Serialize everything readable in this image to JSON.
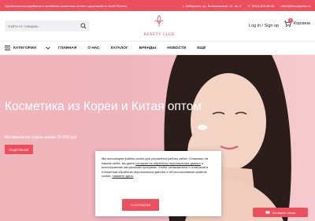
{
  "topbar": {
    "tagline": "Оригинальная корейская и китайская косметика оптом с доставкой по всей России",
    "address": "г. Хабаровск, ул. Большевиков, 12, кв. 4",
    "phone": "+7 (914) 409-89-98",
    "email": "office@beautyclub.ru",
    "color": "#ec4f5e"
  },
  "header": {
    "search_placeholder": "Найти по товарам...",
    "logo_text": "BEAUTY CLUB",
    "account_label": "Log in / Sign up",
    "cart_label": "Корзина",
    "cart_count": "0"
  },
  "nav": {
    "categories_label": "КАТЕГОРИИ",
    "items": [
      "ГЛАВНАЯ",
      "О НАС",
      "КАТАЛОГ",
      "БРЕНДЫ",
      "НОВОСТИ",
      "ЕЩЁ"
    ]
  },
  "hero": {
    "title": "Косметика из Кореи и Китая оптом",
    "subtitle": "Минимальная сумма заказа 10 000 руб.",
    "button": "ПОДРОБНЕЕ"
  },
  "cookie": {
    "text_before_link1": "Мы используем файлы cookie для улучшения работы сайта. Оставаясь на нашем сайте, вы даете ",
    "link1": "согласие на обработку персональных данных",
    "text_mid": " и использование метрических программ. Чтобы ознакомиться с политикой в отношении обработки персональных данных и об использовании файлов cookie, ",
    "link2": "нажмите здесь",
    "text_end": ".",
    "agree_button": "Я СОГЛАСЕН"
  },
  "review_button": "Оставить отзыв"
}
